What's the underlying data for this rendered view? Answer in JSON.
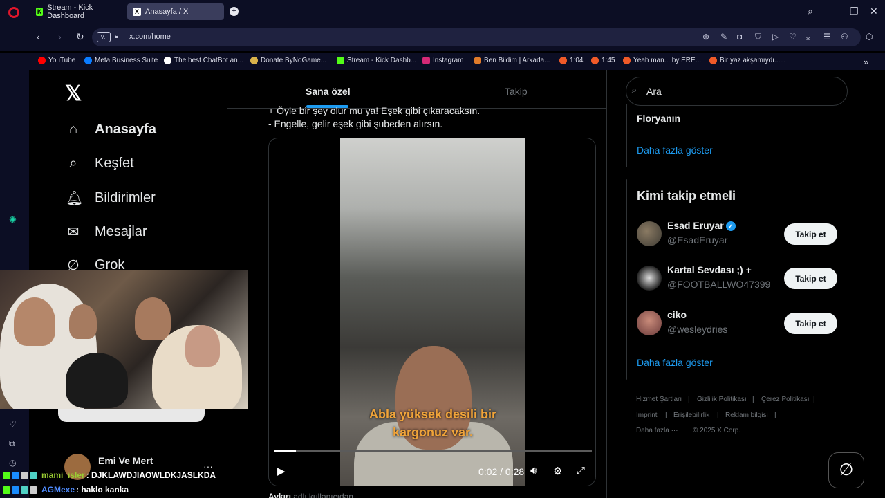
{
  "browser": {
    "tabs": [
      {
        "label": "Stream - Kick Dashboard",
        "active": false
      },
      {
        "label": "Anasayfa / X",
        "active": true
      }
    ],
    "url": "x.com/home",
    "bookmarks": [
      "YouTube",
      "Meta Business Suite",
      "The best ChatBot an...",
      "Donate ByNoGame...",
      "Stream - Kick Dashb...",
      "Instagram",
      "Ben Bildim | Arkada...",
      "1:04",
      "1:45",
      "Yeah man... by ERE...",
      "Bir yaz akşamıydı......"
    ]
  },
  "x_nav": {
    "items": [
      {
        "label": "Anasayfa",
        "icon": "home-icon"
      },
      {
        "label": "Keşfet",
        "icon": "search-icon"
      },
      {
        "label": "Bildirimler",
        "icon": "bell-icon"
      },
      {
        "label": "Mesajlar",
        "icon": "mail-icon"
      },
      {
        "label": "Grok",
        "icon": "grok-icon"
      }
    ],
    "profile_name": "Emi Ve Mert"
  },
  "feed": {
    "tabs": [
      "Sana özel",
      "Takip"
    ],
    "tweet_lines": [
      "+ Öyle bir şey olur mu ya! Eşek gibi çıkaracaksın.",
      "- Engelle, gelir eşek gibi şubeden alırsın."
    ],
    "video": {
      "subtitle_1": "Abla yüksek desili bir",
      "subtitle_2": "kargonuz var.",
      "time": "0:02 / 0:28",
      "progress": 0.07
    },
    "author_name": "Aykırı",
    "author_rest": "adlı kullanıcıdan"
  },
  "right": {
    "search_placeholder": "Ara",
    "trend_partial": "Floryanın",
    "show_more": "Daha fazla göster",
    "who_to_follow": "Kimi takip etmeli",
    "follow_label": "Takip et",
    "suggestions": [
      {
        "name": "Esad Eruyar",
        "handle": "@EsadEruyar",
        "verified": true
      },
      {
        "name": "Kartal Sevdası ;) +",
        "handle": "@FOOTBALLWO47399",
        "verified": false
      },
      {
        "name": "ciko",
        "handle": "@wesleydries",
        "verified": false
      }
    ],
    "footer": {
      "terms": "Hizmet Şartları",
      "privacy": "Gizlilik Politikası",
      "cookies": "Çerez Politikası",
      "imprint": "Imprint",
      "accessibility": "Erişilebilirlik",
      "ads": "Reklam bilgisi",
      "more": "Daha fazla ···",
      "copyright": "© 2025 X Corp."
    }
  },
  "chat": [
    {
      "user": "mami_isler",
      "message": ": DJKLAWDJIAOWLDKJASLKDA",
      "color": "#9acd32"
    },
    {
      "user": "AGMexe",
      "message": ": haklo kanka",
      "color": "#4f8cff"
    }
  ]
}
